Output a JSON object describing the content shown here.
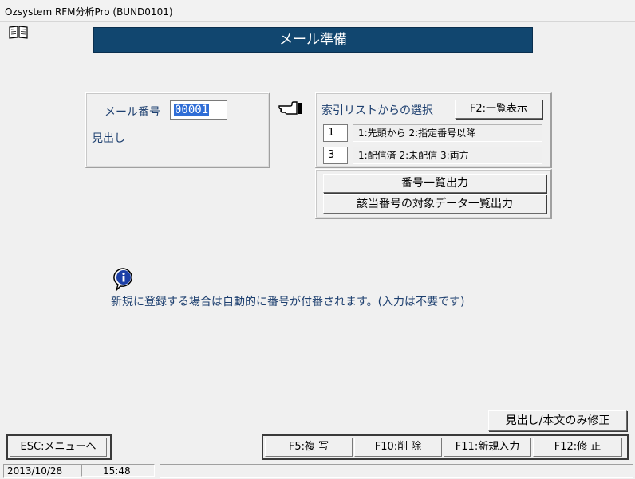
{
  "window": {
    "title": "Ozsystem RFM分析Pro (BUND0101)"
  },
  "icons": {
    "book": "book-icon",
    "hand": "pointing-hand-icon",
    "info": "info-icon"
  },
  "banner": {
    "title": "メール準備"
  },
  "left_panel": {
    "mail_number_label": "メール番号",
    "mail_number_value": "00001",
    "heading_label": "見出し"
  },
  "index_panel": {
    "label": "索引リストからの選択",
    "list_button": "F2:一覧表示",
    "row1": {
      "value": "1",
      "options": "1:先頭から 2:指定番号以降"
    },
    "row2": {
      "value": "3",
      "options": "1:配信済 2:未配信 3:両方"
    }
  },
  "output_buttons": {
    "number_list": "番号一覧出力",
    "target_data_list": "該当番号の対象データ一覧出力"
  },
  "info": {
    "message": "新規に登録する場合は自動的に番号が付番されます。(入力は不要です)"
  },
  "edit_button": "見出し/本文のみ修正",
  "footer": {
    "esc": "ESC:メニューへ",
    "f5": "F5:複 写",
    "f10": "F10:削 除",
    "f11": "F11:新規入力",
    "f12": "F12:修 正"
  },
  "status": {
    "date": "2013/10/28",
    "time": "15:48"
  },
  "colors": {
    "banner_bg": "#11466f",
    "label_text": "#1d3f6f",
    "selection": "#2f6dd6"
  }
}
